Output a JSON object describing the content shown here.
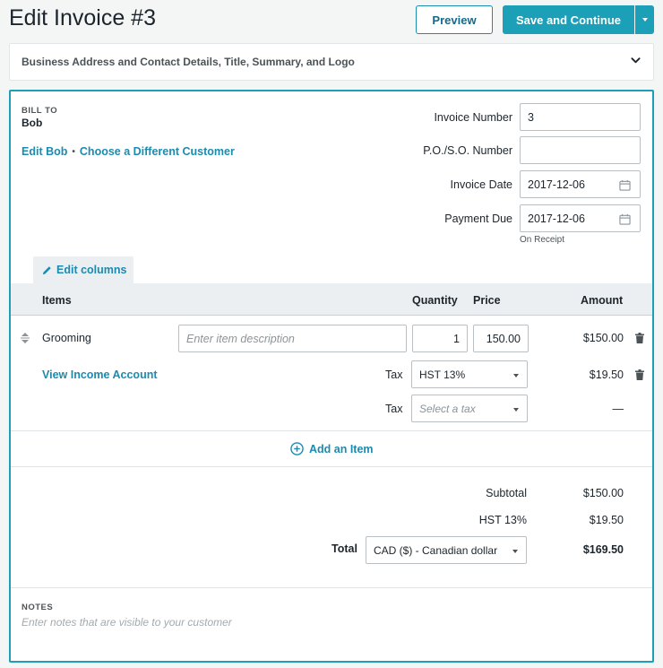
{
  "header": {
    "title": "Edit Invoice #3",
    "preview_label": "Preview",
    "save_label": "Save and Continue"
  },
  "business_section": {
    "label": "Business Address and Contact Details, Title, Summary, and Logo"
  },
  "bill_to": {
    "label": "BILL TO",
    "customer_name": "Bob",
    "edit_link": "Edit Bob",
    "separator": "•",
    "choose_link": "Choose a Different Customer"
  },
  "invoice_meta": {
    "invoice_number_label": "Invoice Number",
    "invoice_number_value": "3",
    "po_label": "P.O./S.O. Number",
    "po_value": "",
    "invoice_date_label": "Invoice Date",
    "invoice_date_value": "2017-12-06",
    "payment_due_label": "Payment Due",
    "payment_due_value": "2017-12-06",
    "payment_due_note": "On Receipt"
  },
  "items": {
    "edit_columns_label": "Edit columns",
    "columns": {
      "items": "Items",
      "quantity": "Quantity",
      "price": "Price",
      "amount": "Amount"
    },
    "rows": [
      {
        "name": "Grooming",
        "description_placeholder": "Enter item description",
        "quantity": "1",
        "price": "150.00",
        "amount": "$150.00",
        "income_link": "View Income Account",
        "taxes": [
          {
            "label": "Tax",
            "value": "HST 13%",
            "amount": "$19.50"
          },
          {
            "label": "Tax",
            "value": "Select a tax",
            "amount": "—"
          }
        ]
      }
    ],
    "add_item_label": "Add an Item"
  },
  "totals": {
    "subtotal_label": "Subtotal",
    "subtotal_value": "$150.00",
    "tax_label": "HST 13%",
    "tax_value": "$19.50",
    "total_label": "Total",
    "currency": "CAD ($) - Canadian dollar",
    "total_value": "$169.50"
  },
  "notes": {
    "label": "NOTES",
    "placeholder": "Enter notes that are visible to your customer"
  },
  "colors": {
    "accent": "#1ba0b8",
    "link": "#1b8bb0",
    "text": "#1c252c"
  }
}
